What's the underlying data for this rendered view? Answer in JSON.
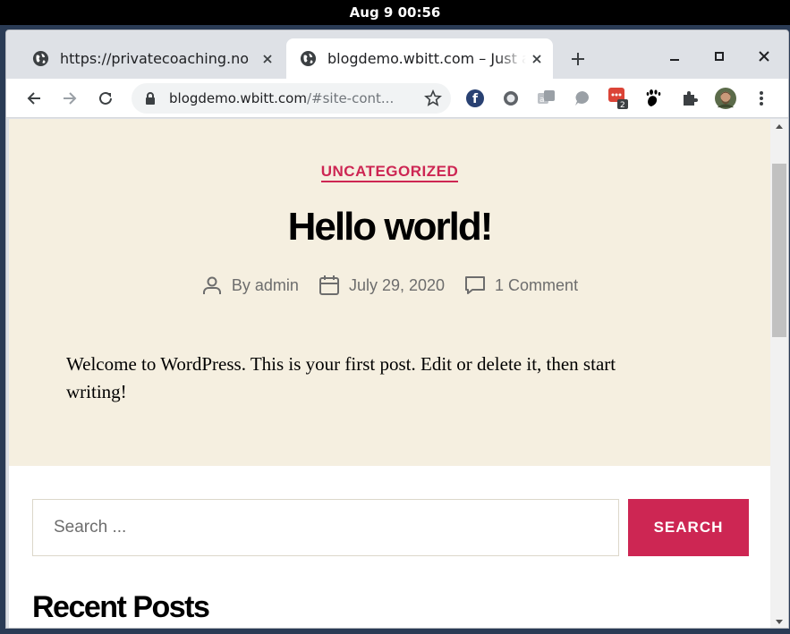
{
  "system": {
    "clock": "Aug 9  00:56"
  },
  "browser": {
    "tabs": [
      {
        "title": "https://privatecoaching.no",
        "icon": "globe-icon",
        "active": false
      },
      {
        "title": "blogdemo.wbitt.com – Just another WordPress site",
        "icon": "globe-icon",
        "active": true
      }
    ],
    "address": {
      "host": "blogdemo.wbitt.com",
      "path": "/#site-cont..."
    },
    "extensions": [
      "fedora-icon",
      "circle-extension-icon",
      "translate-extension-icon",
      "speech-extension-icon",
      "todo-extension-icon",
      "gnome-extension-icon",
      "puzzle-icon",
      "avatar"
    ],
    "badge_count": "2"
  },
  "post": {
    "category": "UNCATEGORIZED",
    "title": "Hello world!",
    "author": "By admin",
    "date": "July 29, 2020",
    "comments": "1 Comment",
    "body": "Welcome to WordPress. This is your first post. Edit or delete it, then start writing!"
  },
  "search": {
    "placeholder": "Search ...",
    "button": "SEARCH"
  },
  "sidebar": {
    "recent_heading": "Recent Posts"
  },
  "colors": {
    "accent": "#cd2653",
    "hero_bg": "#f5efe0"
  }
}
